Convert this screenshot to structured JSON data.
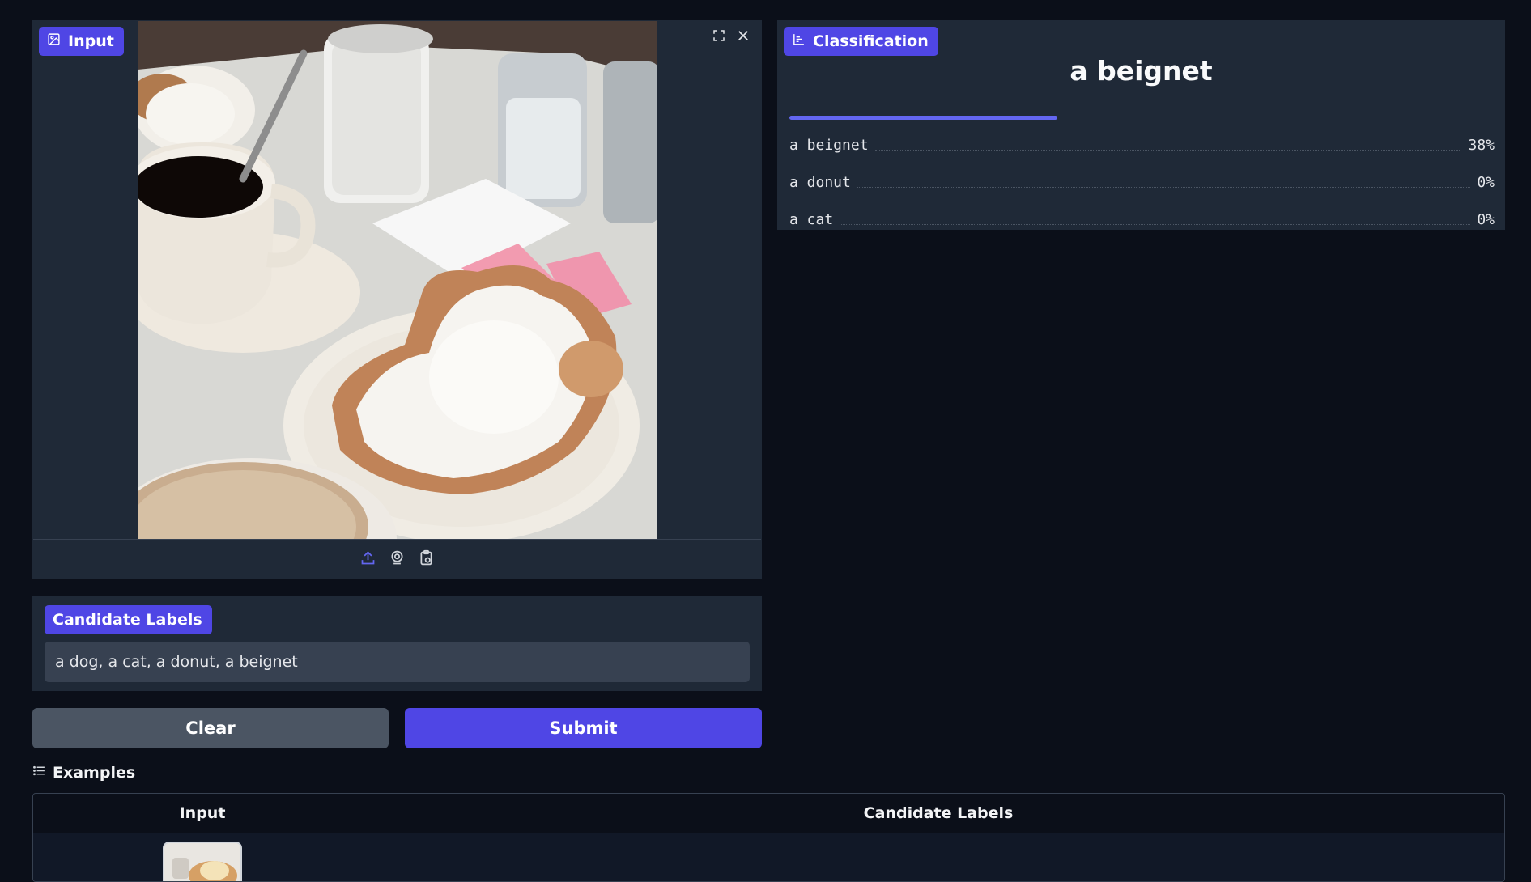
{
  "input_panel": {
    "label": "Input"
  },
  "candidate_labels": {
    "label": "Candidate Labels",
    "value": "a dog, a cat, a donut, a beignet"
  },
  "buttons": {
    "clear": "Clear",
    "submit": "Submit"
  },
  "examples": {
    "title": "Examples",
    "columns": [
      "Input",
      "Candidate Labels"
    ]
  },
  "classification": {
    "label": "Classification",
    "top_label": "a beignet",
    "top_confidence": 0.38,
    "results": [
      {
        "label": "a beignet",
        "confidence": "38%"
      },
      {
        "label": "a donut",
        "confidence": "0%"
      },
      {
        "label": "a cat",
        "confidence": "0%"
      }
    ]
  },
  "icons": {
    "input_badge": "image-icon",
    "classification_badge": "bar-chart-icon",
    "upload": "upload-icon",
    "webcam": "webcam-icon",
    "clipboard": "clipboard-icon",
    "fullscreen": "fullscreen-icon",
    "close": "close-icon",
    "examples": "list-icon"
  },
  "colors": {
    "accent": "#4f46e5",
    "panel": "#1f2937",
    "background": "#0b0f19"
  }
}
